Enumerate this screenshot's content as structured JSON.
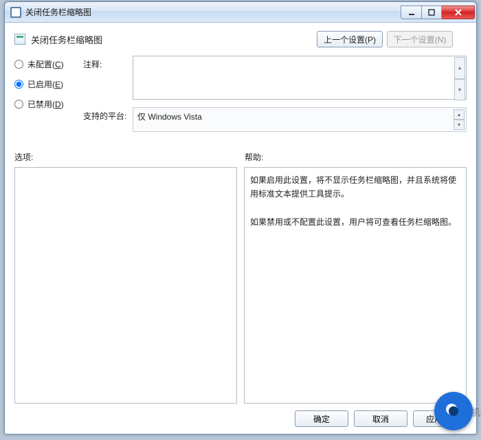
{
  "window": {
    "title": "关闭任务栏缩略图"
  },
  "header": {
    "policy_title": "关闭任务栏缩略图",
    "prev_button": "上一个设置(P)",
    "next_button": "下一个设置(N)"
  },
  "radios": {
    "not_configured": "未配置",
    "not_configured_hk": "C",
    "enabled": "已启用",
    "enabled_hk": "E",
    "disabled": "已禁用",
    "disabled_hk": "D",
    "selected": "enabled"
  },
  "fields": {
    "comment_label": "注释:",
    "comment_value": "",
    "platform_label": "支持的平台:",
    "platform_value": "仅 Windows Vista"
  },
  "columns": {
    "options_label": "选项:",
    "help_label": "帮助:"
  },
  "help_text": {
    "p1": "如果启用此设置，将不显示任务栏缩略图，并且系统将使用标准文本提供工具提示。",
    "p2": "如果禁用或不配置此设置，用户将可查看任务栏缩略图。"
  },
  "footer": {
    "ok": "确定",
    "cancel": "取消",
    "apply": "应用(A)"
  },
  "watermark": "好装机"
}
